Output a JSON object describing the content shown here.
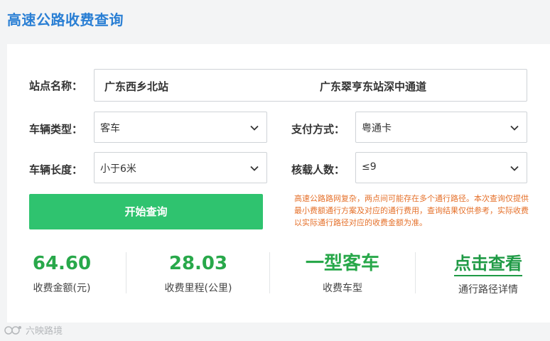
{
  "page": {
    "title": "高速公路收费查询"
  },
  "form": {
    "station_label": "站点名称：",
    "from_station": "广东西乡北站",
    "to_station": "广东翠亨东站深中通道",
    "vehicle_type_label": "车辆类型：",
    "vehicle_type_value": "客车",
    "payment_label": "支付方式：",
    "payment_value": "粤通卡",
    "vehicle_length_label": "车辆长度：",
    "vehicle_length_value": "小于6米",
    "capacity_label": "核载人数：",
    "capacity_value": "≤9",
    "search_button": "开始查询",
    "note": "高速公路路网复杂，两点间可能存在多个通行路径。本次查询仅提供最小费额通行方案及对应的通行费用，查询结果仅供参考，实际收费以实际通行路径对应的收费金额为准。"
  },
  "results": {
    "fee_value": "64.60",
    "fee_caption": "收费金额(元)",
    "distance_value": "28.03",
    "distance_caption": "收费里程(公里)",
    "vehicle_class_value": "一型客车",
    "vehicle_class_caption": "收费车型",
    "route_link": "点击查看",
    "route_caption": "通行路径详情"
  },
  "watermark": {
    "text": "六映路境"
  },
  "colors": {
    "title_blue": "#2a7fd4",
    "button_green": "#2fc36f",
    "result_green": "#28a84a",
    "note_orange": "#e5702a"
  },
  "icons": {
    "select_chevron": "chevron-down-icon"
  }
}
